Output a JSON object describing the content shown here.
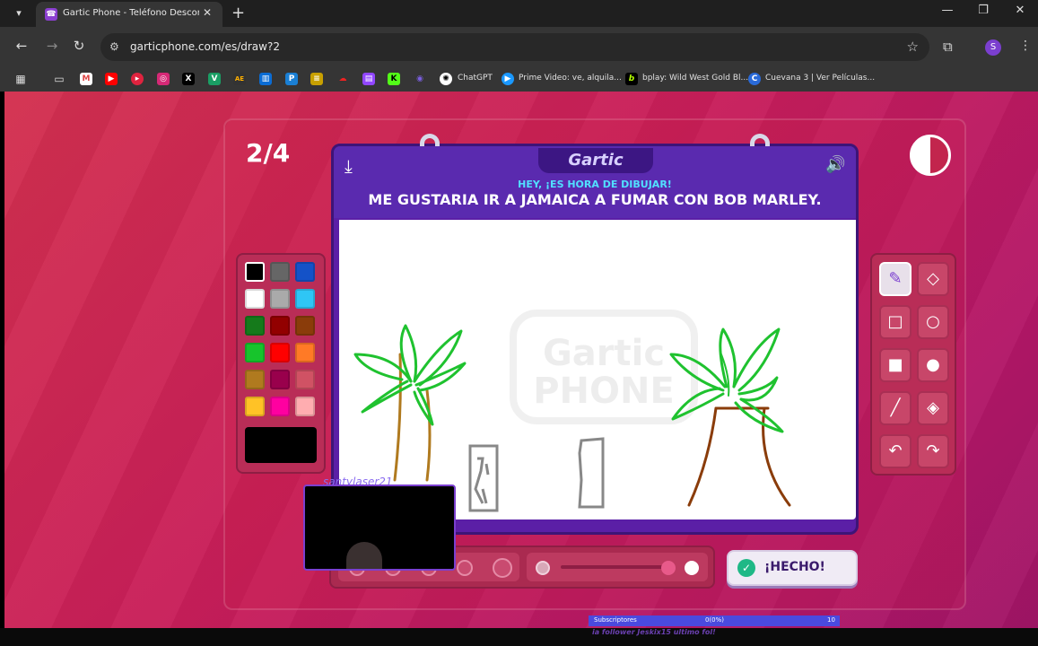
{
  "browser": {
    "tab_title": "Gartic Phone - Teléfono Descompuest",
    "url": "garticphone.com/es/draw?2",
    "profile_initial": "S",
    "bookmarks": [
      {
        "label": "ChatGPT"
      },
      {
        "label": "Prime Video: ve, alquila..."
      },
      {
        "label": "bplay: Wild West Gold Bl..."
      },
      {
        "label": "Cuevana 3 | Ver Películas..."
      }
    ]
  },
  "game": {
    "round": "2/4",
    "logo": "Gartic",
    "prompt_sub": "HEY, ¡ES HORA DE DIBUJAR!",
    "prompt_main": "ME GUSTARIA IR A JAMAICA A FUMAR CON BOB MARLEY.",
    "done_label": "¡HECHO!",
    "watermark_top": "Gartic",
    "watermark_bottom": "PHONE",
    "webcam_name": "santylaser21"
  },
  "palette": {
    "colors": [
      "#000000",
      "#666666",
      "#1452c8",
      "#ffffff",
      "#aaaaaa",
      "#2fc6f5",
      "#157a1b",
      "#920000",
      "#8a3c0a",
      "#17c42c",
      "#ff0000",
      "#ff7a26",
      "#b07a1f",
      "#99004c",
      "#d05264",
      "#ffc226",
      "#ff00a0",
      "#ffadb0"
    ],
    "selected": "#000000",
    "current": "#000000"
  },
  "colors": {
    "accent": "#5b1fa6",
    "palm_leaves": "#1fc22f",
    "trunk_left": "#b07a1f",
    "trunk_right": "#8a3c0a",
    "sketch_gray": "#888888"
  },
  "stream": {
    "label": "Subscriptores",
    "progress_text": "0(0%)",
    "goal": "10",
    "follower": "ia follower Jeskix15  ultimo fol!"
  }
}
